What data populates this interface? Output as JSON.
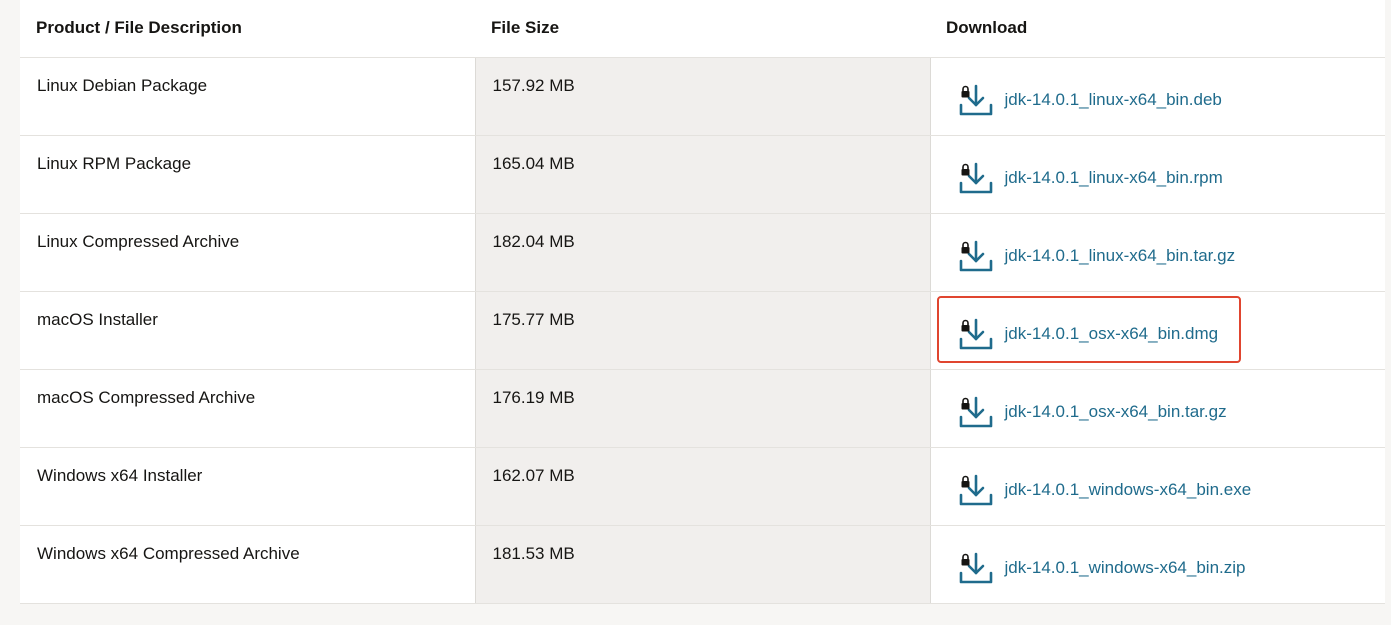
{
  "table": {
    "headers": {
      "product": "Product / File Description",
      "size": "File Size",
      "download": "Download"
    },
    "rows": [
      {
        "product": "Linux Debian Package",
        "size": "157.92 MB",
        "file": "jdk-14.0.1_linux-x64_bin.deb"
      },
      {
        "product": "Linux RPM Package",
        "size": "165.04 MB",
        "file": "jdk-14.0.1_linux-x64_bin.rpm"
      },
      {
        "product": "Linux Compressed Archive",
        "size": "182.04 MB",
        "file": "jdk-14.0.1_linux-x64_bin.tar.gz"
      },
      {
        "product": "macOS Installer",
        "size": "175.77 MB",
        "file": "jdk-14.0.1_osx-x64_bin.dmg"
      },
      {
        "product": "macOS Compressed Archive",
        "size": "176.19 MB",
        "file": "jdk-14.0.1_osx-x64_bin.tar.gz"
      },
      {
        "product": "Windows x64 Installer",
        "size": "162.07 MB",
        "file": "jdk-14.0.1_windows-x64_bin.exe"
      },
      {
        "product": "Windows x64 Compressed Archive",
        "size": "181.53 MB",
        "file": "jdk-14.0.1_windows-x64_bin.zip"
      }
    ]
  },
  "icons": {
    "download": "lock-download-icon"
  },
  "highlight": {
    "row_file": "jdk-14.0.1_osx-x64_bin.dmg",
    "color": "#e0452f"
  },
  "colors": {
    "link": "#1f6b8c",
    "size_column_bg": "#f1efed"
  }
}
